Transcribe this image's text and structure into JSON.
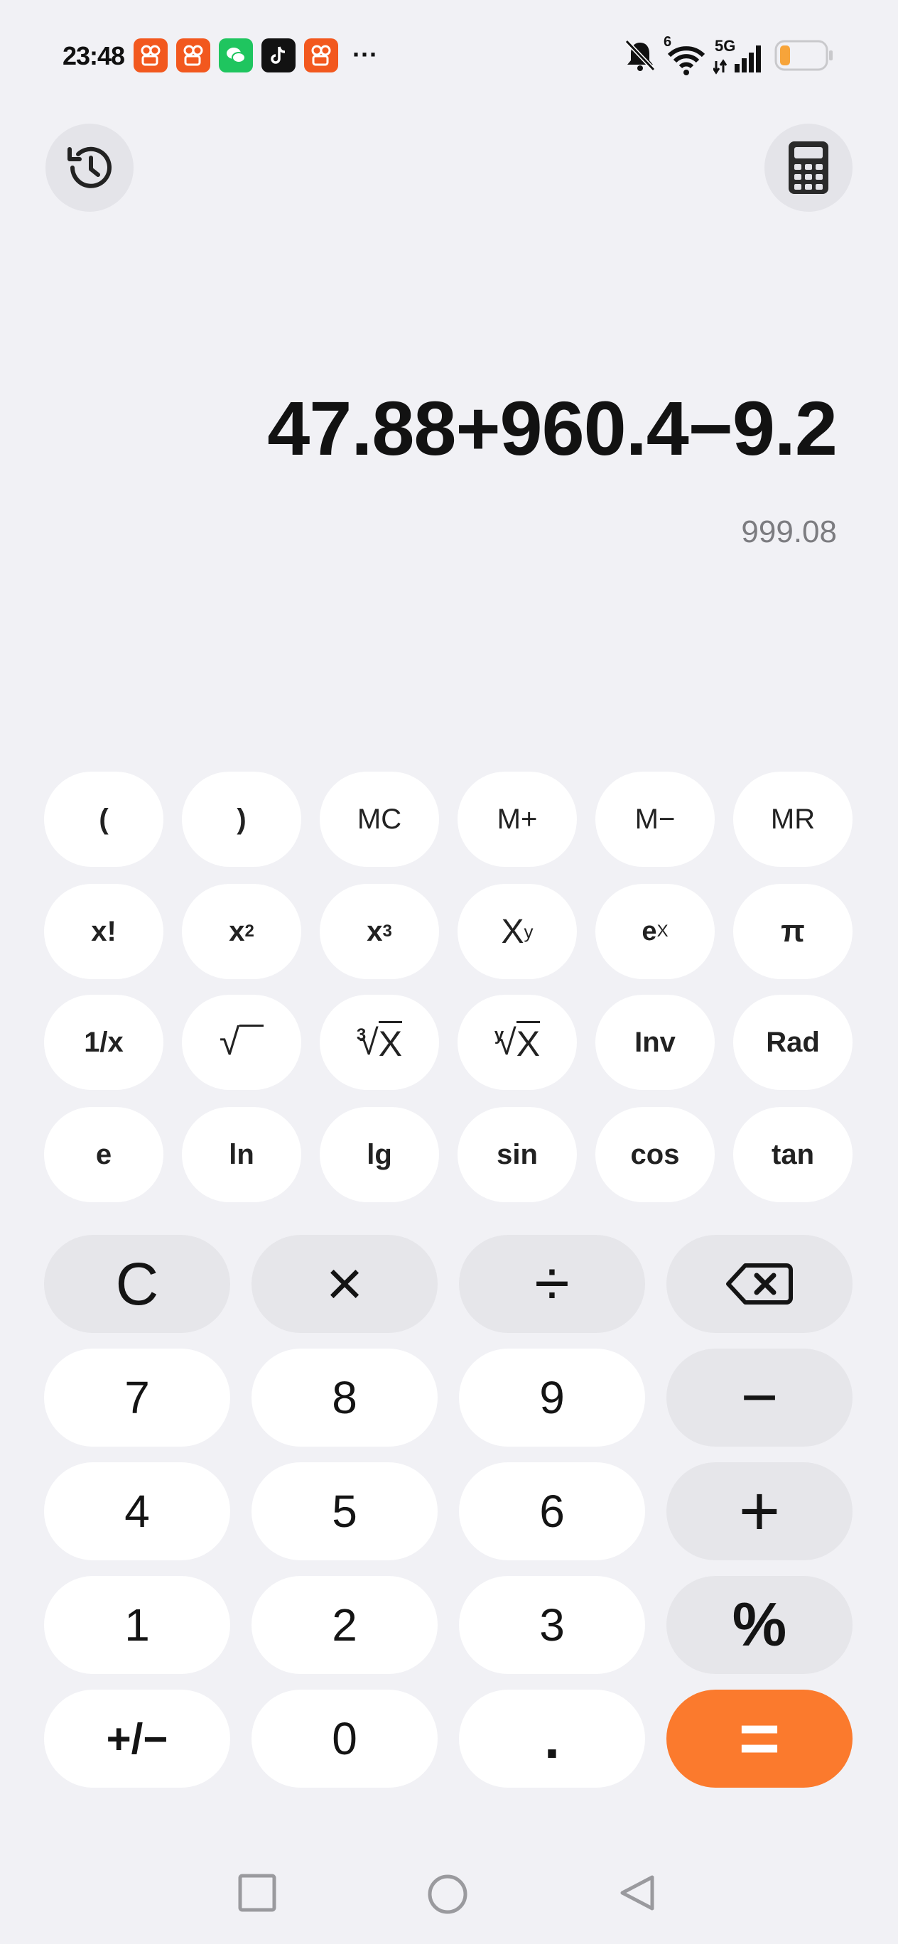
{
  "status_bar": {
    "time": "23:48",
    "more": "···",
    "app_icons": [
      "kuaishou-icon",
      "kuaishou-icon",
      "wechat-icon",
      "tiktok-icon",
      "kuaishou-icon"
    ],
    "right_icons": [
      "bell-muted-icon",
      "wifi-icon",
      "signal-5g-icon",
      "battery-icon"
    ],
    "wifi_badge": "6",
    "network_label": "5G",
    "colors": {
      "app_orange": "#f2581e",
      "wechat_green": "#1fc55f",
      "tiktok_black": "#121212",
      "battery_level": "#f7a43a"
    }
  },
  "toolbar": {
    "history_icon": "history-icon",
    "mode_icon": "calculator-icon"
  },
  "display": {
    "expression": "47.88+960.4−9.2",
    "result": "999.08"
  },
  "scientific_keys": {
    "row1": [
      "(",
      ")",
      "MC",
      "M+",
      "M−",
      "MR"
    ],
    "row2": {
      "factorial": "x!",
      "x": "x",
      "sq_exp": "2",
      "cube_exp": "3",
      "X": "X",
      "y": "y",
      "e": "e",
      "ex_exp": "X",
      "pi": "π"
    },
    "row3": {
      "reciprocal": "1/x",
      "sqrt_symbol": "√",
      "cbrt_index": "3",
      "root_x": "X",
      "yroot_index": "y",
      "inv": "Inv",
      "rad": "Rad"
    },
    "row4": [
      "e",
      "ln",
      "lg",
      "sin",
      "cos",
      "tan"
    ]
  },
  "main_keys": {
    "clear": "C",
    "multiply": "×",
    "divide": "÷",
    "backspace_icon": "backspace-icon",
    "digits": {
      "d7": "7",
      "d8": "8",
      "d9": "9",
      "d4": "4",
      "d5": "5",
      "d6": "6",
      "d1": "1",
      "d2": "2",
      "d3": "3",
      "d0": "0"
    },
    "minus": "−",
    "plus": "+",
    "percent": "%",
    "sign": "+/−",
    "decimal": ".",
    "equals": "=",
    "accent_color": "#fb7a2d"
  },
  "nav_bar": {
    "recents_icon": "square-icon",
    "home_icon": "circle-icon",
    "back_icon": "triangle-back-icon"
  }
}
